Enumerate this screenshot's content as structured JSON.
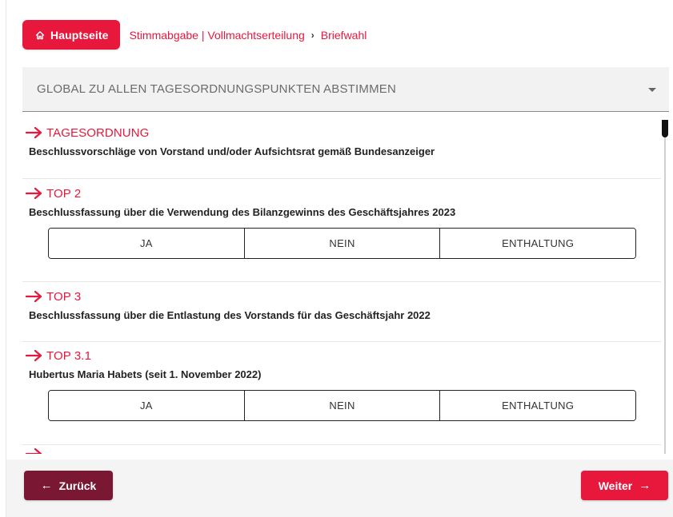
{
  "breadcrumb": {
    "home_label": "Hauptseite",
    "crumb1": "Stimmabgabe | Vollmachtserteilung",
    "separator": "›",
    "crumb2": "Briefwahl"
  },
  "global_vote": {
    "label": "GLOBAL ZU ALLEN TAGESORDNUNGSPUNKTEN ABSTIMMEN"
  },
  "agenda": [
    {
      "title": "TAGESORDNUNG",
      "description": "Beschlussvorschläge von Vorstand und/oder Aufsichtsrat gemäß Bundesanzeiger"
    },
    {
      "title": "TOP 2",
      "description": "Beschlussfassung über die Verwendung des Bilanzgewinns des Geschäftsjahres 2023"
    },
    {
      "title": "TOP 3",
      "description": "Beschlussfassung über die Entlastung des Vorstands für das Geschäftsjahr 2022"
    },
    {
      "title": "TOP 3.1",
      "description": "Hubertus Maria Habets (seit 1. November 2022)"
    }
  ],
  "vote_options": {
    "yes": "JA",
    "no": "NEIN",
    "abstain": "ENTHALTUNG"
  },
  "footer": {
    "back_label": "Zurück",
    "next_label": "Weiter",
    "back_icon": "←",
    "next_icon": "→"
  },
  "colors": {
    "accent": "#e8173c",
    "back_button": "#7a1732"
  }
}
